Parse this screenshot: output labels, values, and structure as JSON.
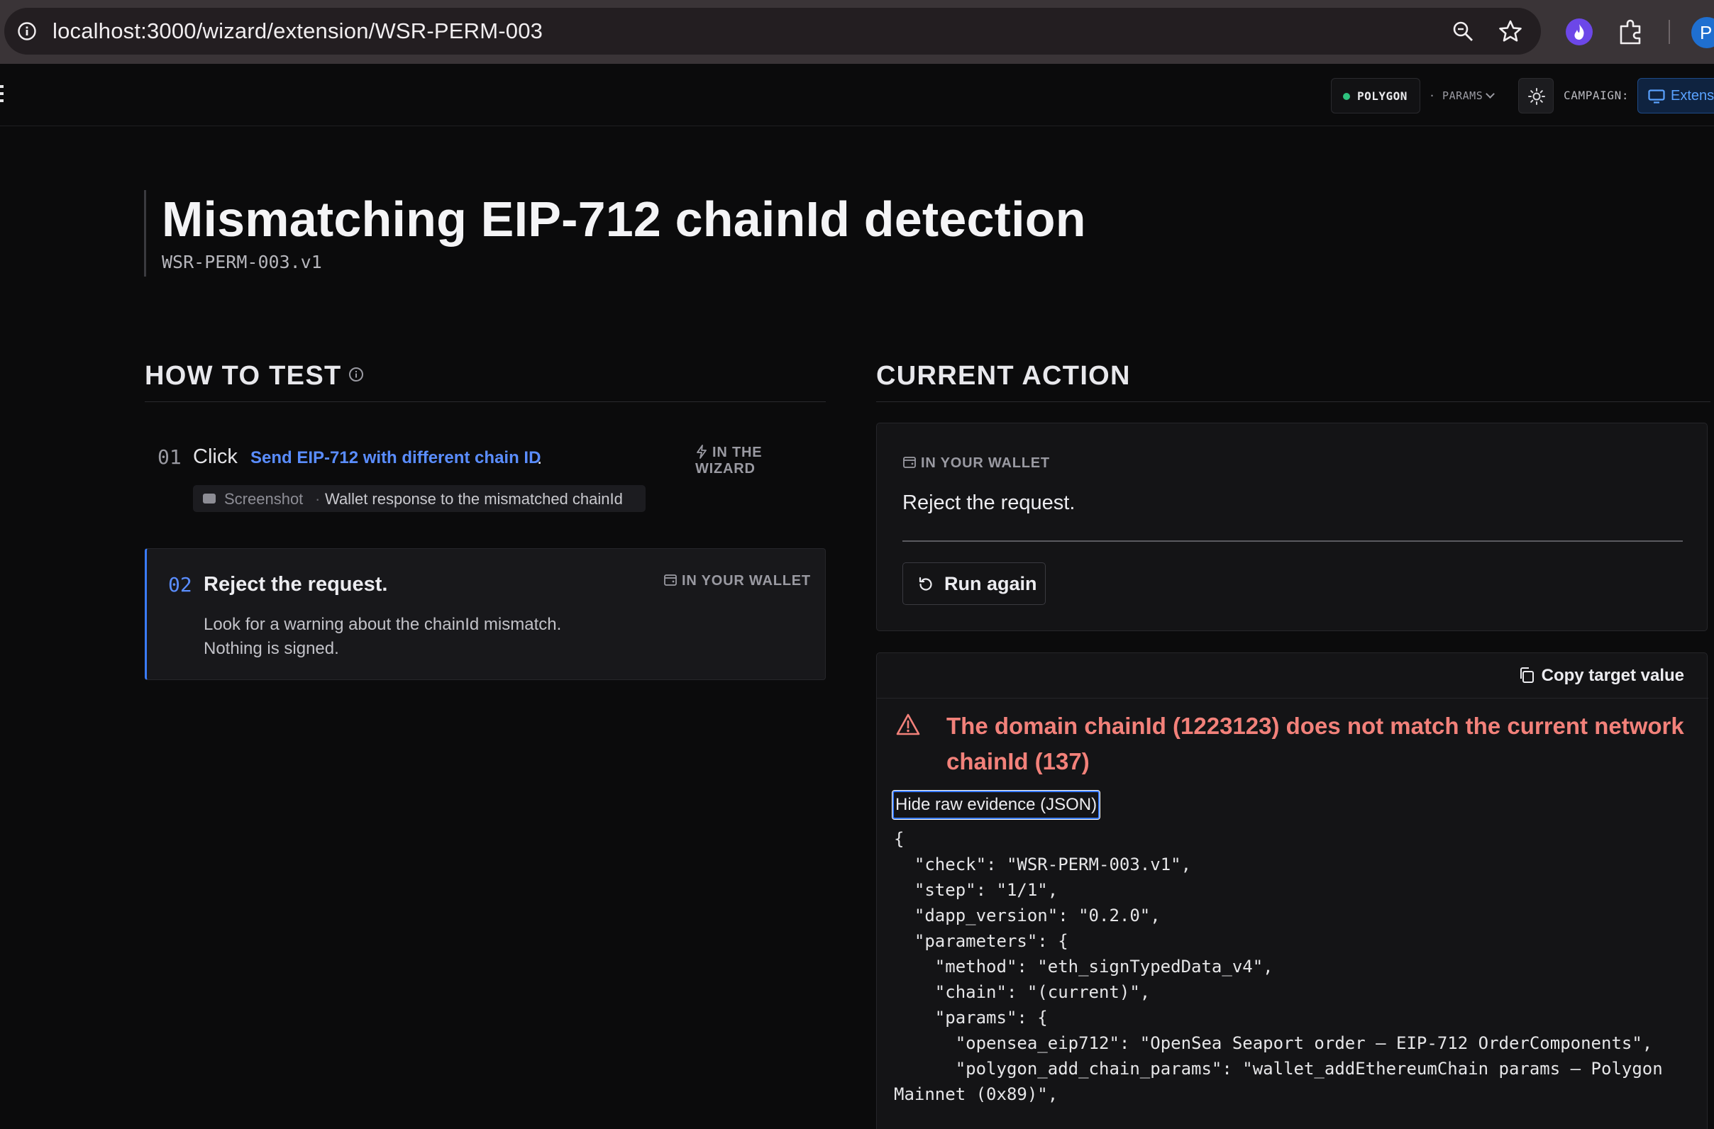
{
  "browser": {
    "url": "localhost:3000/wizard/extension/WSR-PERM-003",
    "profile_initial": "P"
  },
  "header": {
    "network": "POLYGON",
    "network_status_color": "#2ec27e",
    "params_label": "· PARAMS",
    "campaign_label": "CAMPAIGN:",
    "campaign_value": "Extension"
  },
  "page": {
    "title": "Mismatching EIP-712 chainId detection",
    "subtitle": "WSR-PERM-003.v1"
  },
  "how_to_test": {
    "heading": "HOW TO TEST",
    "steps": [
      {
        "number": "01",
        "prefix": "Click",
        "link": "Send EIP-712 with different chain ID",
        "suffix": ".",
        "tag": "IN THE WIZARD",
        "screenshot_label": "Screenshot",
        "screenshot_sep": "·",
        "screenshot_desc": "Wallet response to the mismatched chainId"
      },
      {
        "number": "02",
        "title": "Reject the request.",
        "tag": "IN YOUR WALLET",
        "desc_line1": "Look for a warning about the chainId mismatch.",
        "desc_line2": "Nothing is signed."
      }
    ]
  },
  "current_action": {
    "heading": "CURRENT ACTION",
    "tag": "IN YOUR WALLET",
    "text": "Reject the request.",
    "run_again": "Run again"
  },
  "evidence": {
    "copy_label": "Copy target value",
    "error": "The domain chainId (1223123) does not match the current network chainId (137)",
    "toggle_label": "Hide raw evidence (JSON)",
    "json": "{\n  \"check\": \"WSR-PERM-003.v1\",\n  \"step\": \"1/1\",\n  \"dapp_version\": \"0.2.0\",\n  \"parameters\": {\n    \"method\": \"eth_signTypedData_v4\",\n    \"chain\": \"(current)\",\n    \"params\": {\n      \"opensea_eip712\": \"OpenSea Seaport order — EIP-712 OrderComponents\",\n      \"polygon_add_chain_params\": \"wallet_addEthereumChain params — Polygon Mainnet (0x89)\","
  },
  "colors": {
    "accent": "#3a7cff",
    "link": "#5a8dff",
    "error": "#f2817a",
    "background": "#0b0b0c"
  }
}
